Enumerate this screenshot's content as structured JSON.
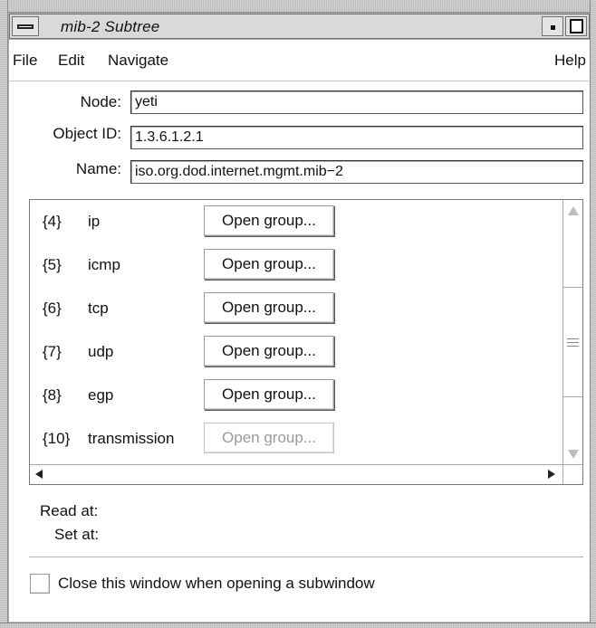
{
  "window": {
    "title": "mib-2 Subtree"
  },
  "menubar": {
    "file": "File",
    "edit": "Edit",
    "navigate": "Navigate",
    "help": "Help"
  },
  "form": {
    "node_label": "Node:",
    "node_value": "yeti",
    "object_id_label": "Object ID:",
    "object_id_value": "1.3.6.1.2.1",
    "name_label": "Name:",
    "name_value": "iso.org.dod.internet.mgmt.mib−2"
  },
  "groups": [
    {
      "num": "{4}",
      "name": "ip",
      "button": "Open group...",
      "enabled": true
    },
    {
      "num": "{5}",
      "name": "icmp",
      "button": "Open group...",
      "enabled": true
    },
    {
      "num": "{6}",
      "name": "tcp",
      "button": "Open group...",
      "enabled": true
    },
    {
      "num": "{7}",
      "name": "udp",
      "button": "Open group...",
      "enabled": true
    },
    {
      "num": "{8}",
      "name": "egp",
      "button": "Open group...",
      "enabled": true
    },
    {
      "num": "{10}",
      "name": "transmission",
      "button": "Open group...",
      "enabled": false
    }
  ],
  "status": {
    "read_at_label": "Read at:",
    "set_at_label": "Set at:"
  },
  "options": {
    "close_on_subwindow_label": "Close this window when opening a subwindow",
    "close_on_subwindow_checked": false
  }
}
